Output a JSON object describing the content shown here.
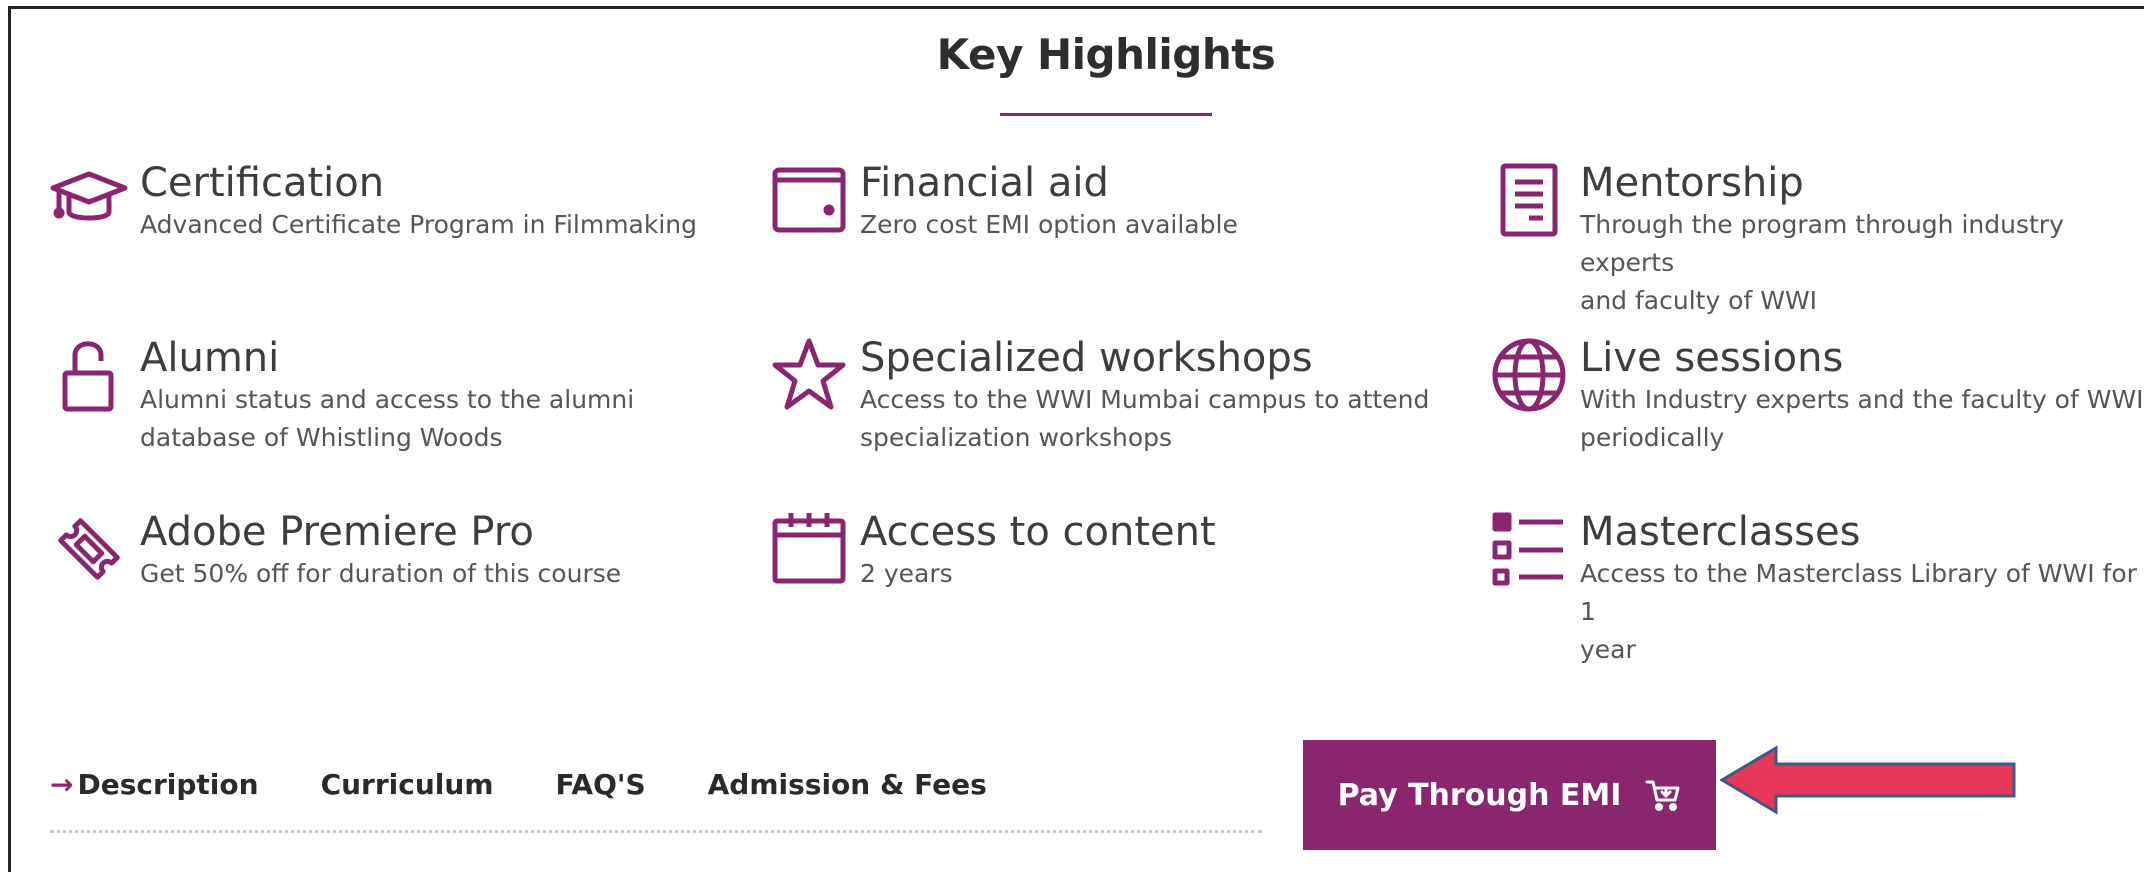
{
  "section": {
    "title": "Key Highlights"
  },
  "highlights": [
    {
      "icon": "graduation-cap-icon",
      "title": "Certification",
      "desc": "Advanced Certificate Program in Filmmaking",
      "desc2": ""
    },
    {
      "icon": "wallet-icon",
      "title": "Financial aid",
      "desc": "Zero cost EMI option available",
      "desc2": ""
    },
    {
      "icon": "document-icon",
      "title": "Mentorship",
      "desc": "Through the program through industry experts",
      "desc2": "and faculty of WWI"
    },
    {
      "icon": "unlocked-padlock-icon",
      "title": "Alumni",
      "desc": "Alumni status and access to the alumni",
      "desc2": "database of Whistling Woods"
    },
    {
      "icon": "star-icon",
      "title": "Specialized workshops",
      "desc": "Access to the WWI Mumbai campus to attend",
      "desc2": "specialization workshops"
    },
    {
      "icon": "globe-icon",
      "title": "Live sessions",
      "desc": "With Industry experts and the faculty of WWI",
      "desc2": "periodically"
    },
    {
      "icon": "ticket-icon",
      "title": "Adobe Premiere Pro",
      "desc": "Get 50% off for duration of this course",
      "desc2": ""
    },
    {
      "icon": "calendar-icon",
      "title": "Access to content",
      "desc": "2 years",
      "desc2": ""
    },
    {
      "icon": "checklist-icon",
      "title": "Masterclasses",
      "desc": "Access to the Masterclass Library of WWI for 1",
      "desc2": "year"
    }
  ],
  "tabs": {
    "arrow": "→",
    "items": [
      "Description",
      "Curriculum",
      "FAQ'S",
      "Admission & Fees"
    ]
  },
  "cta": {
    "label": "Pay Through EMI",
    "icon": "cart-icon"
  },
  "colors": {
    "accent": "#8a2570",
    "annotation_arrow": "#e8385a",
    "annotation_outline": "#3b5a8a"
  }
}
